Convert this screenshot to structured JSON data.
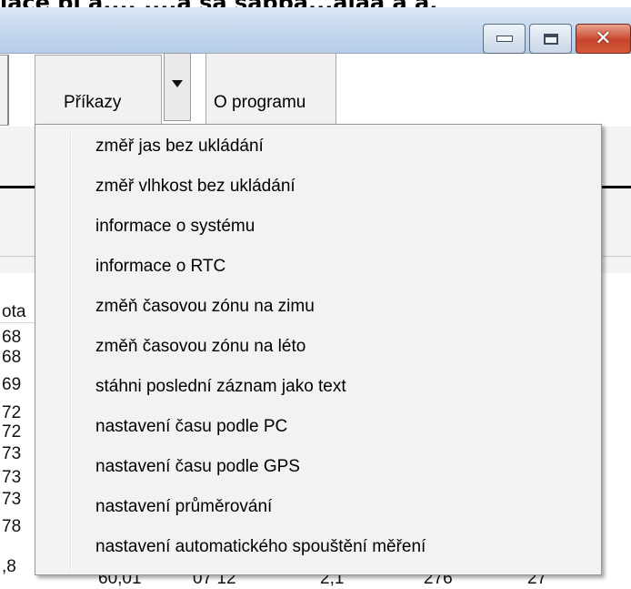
{
  "window": {
    "top_caption": "lace pl a..., ....a sa sabba...ajaa a a.",
    "minimize_label": "",
    "close_glyph": "✕"
  },
  "toolbar": {
    "prikazy_label": "Příkazy",
    "o_programu_label": "O programu"
  },
  "background_table": {
    "header_fragment": "ota",
    "rows": [
      "68",
      "68",
      "69",
      "72",
      "72",
      "73",
      "73",
      "73",
      "78",
      ",8"
    ],
    "bottom_fragments": [
      "60,01",
      "07 12",
      "2,1",
      "276",
      "27"
    ]
  },
  "menu": {
    "items": [
      "změř jas bez ukládání",
      "změř vlhkost bez ukládání",
      "informace o systému",
      "informace o RTC",
      "změň časovou zónu na zimu",
      "změň časovou zónu na léto",
      "stáhni poslední záznam jako text",
      "nastavení času podle PC",
      "nastavení času podle GPS",
      "nastavení průměrování",
      "nastavení automatického spouštění měření"
    ]
  }
}
